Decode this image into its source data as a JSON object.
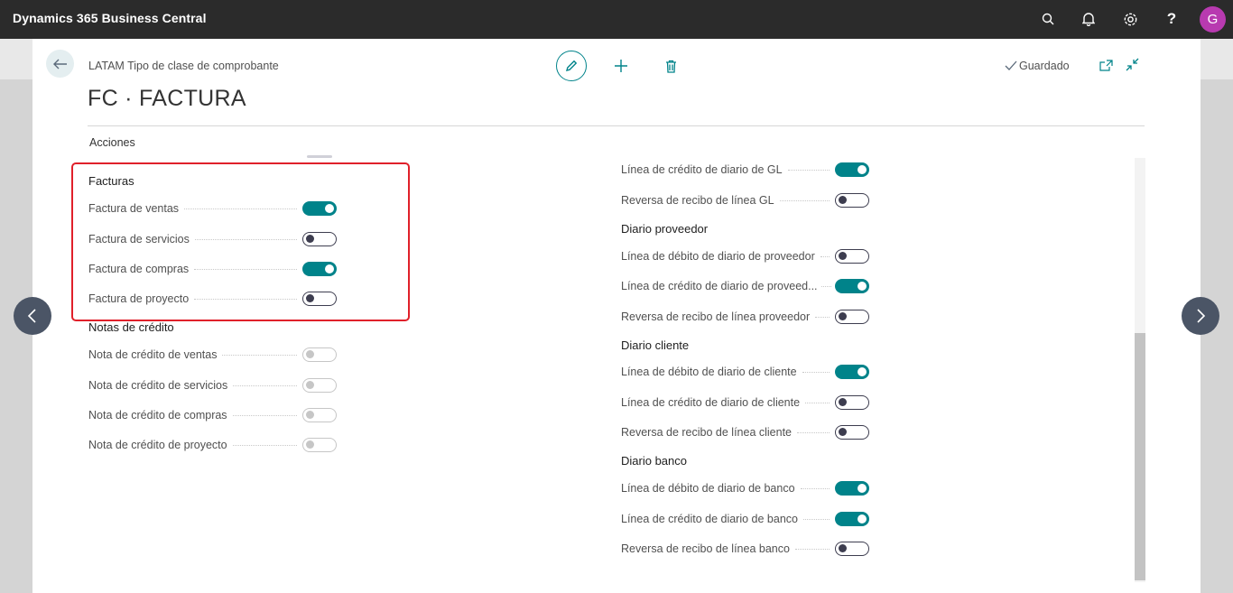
{
  "app": {
    "title": "Dynamics 365 Business Central",
    "user_initial": "G"
  },
  "topbar_icons": [
    "search-icon",
    "bell-icon",
    "gear-icon",
    "help-icon"
  ],
  "header": {
    "breadcrumb": "LATAM Tipo de clase de comprobante",
    "title": "FC · FACTURA",
    "saved_status": "Guardado",
    "actions_label": "Acciones"
  },
  "colors": {
    "accent": "#00838a",
    "topbar": "#2b2b2b",
    "highlight": "#e0202a",
    "avatar": "#b83ab0"
  },
  "left": {
    "facturas": {
      "title": "Facturas",
      "items": [
        {
          "label": "Factura de ventas",
          "state": "on"
        },
        {
          "label": "Factura de servicios",
          "state": "off"
        },
        {
          "label": "Factura de compras",
          "state": "on"
        },
        {
          "label": "Factura de proyecto",
          "state": "off"
        }
      ]
    },
    "notas": {
      "title": "Notas de crédito",
      "items": [
        {
          "label": "Nota de crédito de ventas",
          "state": "disabled"
        },
        {
          "label": "Nota de crédito de servicios",
          "state": "disabled"
        },
        {
          "label": "Nota de crédito de compras",
          "state": "disabled"
        },
        {
          "label": "Nota de crédito de proyecto",
          "state": "disabled"
        }
      ]
    }
  },
  "right": {
    "gl": {
      "items": [
        {
          "label": "Línea de crédito de diario de GL",
          "state": "on"
        },
        {
          "label": "Reversa de recibo de línea GL",
          "state": "off"
        }
      ]
    },
    "proveedor": {
      "title": "Diario proveedor",
      "items": [
        {
          "label": "Línea de débito de diario de proveedor",
          "state": "off"
        },
        {
          "label": "Línea de crédito de diario de proveed...",
          "state": "on"
        },
        {
          "label": "Reversa de recibo de línea proveedor",
          "state": "off"
        }
      ]
    },
    "cliente": {
      "title": "Diario cliente",
      "items": [
        {
          "label": "Línea de débito de diario de cliente",
          "state": "on"
        },
        {
          "label": "Línea de crédito de diario de cliente",
          "state": "off"
        },
        {
          "label": "Reversa de recibo de línea cliente",
          "state": "off"
        }
      ]
    },
    "banco": {
      "title": "Diario banco",
      "items": [
        {
          "label": "Línea de débito de diario de banco",
          "state": "on"
        },
        {
          "label": "Línea de crédito de diario de banco",
          "state": "on"
        },
        {
          "label": "Reversa de recibo de línea banco",
          "state": "off"
        }
      ]
    }
  }
}
